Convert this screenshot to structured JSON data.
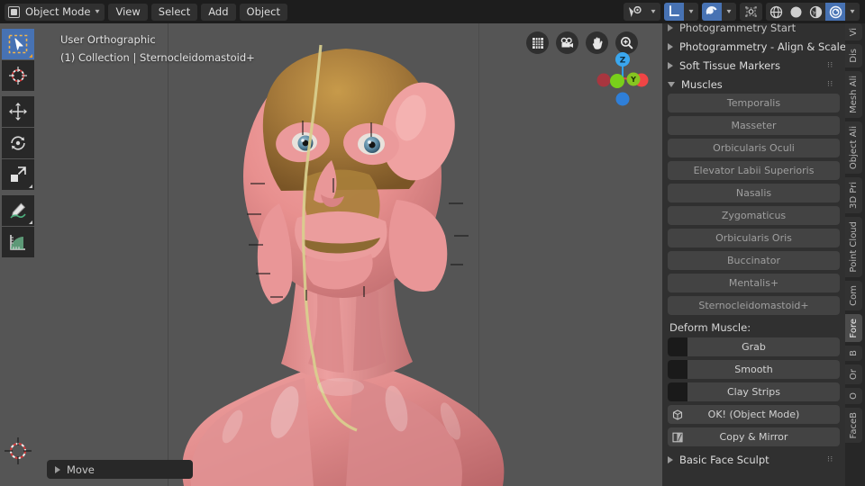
{
  "app": {
    "name": "Blender 3D Viewport",
    "accent": "#4772b3",
    "panel_bg": "#303030",
    "viewport_bg": "#555555"
  },
  "topbar": {
    "mode_selector": {
      "label": "Object Mode",
      "icon": "object-mode-icon",
      "chevron": "▾"
    },
    "menus": [
      {
        "label": "View"
      },
      {
        "label": "Select"
      },
      {
        "label": "Add"
      },
      {
        "label": "Object"
      }
    ],
    "right_controls": [
      {
        "name": "visibility-icon",
        "glyph": "◉",
        "active": false
      },
      {
        "name": "visibility-dropdown",
        "glyph": "▾",
        "active": false
      },
      {
        "name": "transform-orientation-icon",
        "glyph": "└",
        "active": true
      },
      {
        "name": "transform-orientation-dropdown",
        "glyph": "▾",
        "active": false
      },
      {
        "name": "snap-magnet-icon",
        "glyph": "◑",
        "active": true
      },
      {
        "name": "snap-dropdown",
        "glyph": "▾",
        "active": false
      },
      {
        "name": "proportional-editing-icon",
        "glyph": "⬚",
        "active": false
      },
      {
        "name": "shading-wireframe-icon",
        "glyph": "⊕",
        "active": false
      },
      {
        "name": "shading-solid-icon",
        "glyph": "●",
        "active": false
      },
      {
        "name": "shading-material-preview-icon",
        "glyph": "◕",
        "active": false
      },
      {
        "name": "shading-rendered-icon",
        "glyph": "◎",
        "active": true
      },
      {
        "name": "shading-dropdown",
        "glyph": "▾",
        "active": false
      }
    ]
  },
  "toolbar": {
    "tools": [
      {
        "name": "tweak-select-box-tool",
        "icon": "cursor-arrow-icon",
        "selected": true
      },
      {
        "name": "cursor-tool",
        "icon": "3d-cursor-icon",
        "selected": false
      },
      {
        "name": "move-tool",
        "icon": "move-arrows-icon",
        "selected": false
      },
      {
        "name": "rotate-tool",
        "icon": "rotate-icon",
        "selected": false
      },
      {
        "name": "scale-tool",
        "icon": "scale-icon",
        "selected": false
      },
      {
        "name": "annotate-tool",
        "icon": "pencil-icon",
        "selected": false
      },
      {
        "name": "measure-tool",
        "icon": "ruler-icon",
        "selected": false
      }
    ]
  },
  "viewport": {
    "view_name": "User Orthographic",
    "collection_line": "(1) Collection | Sternocleidomastoid+",
    "nav_buttons": [
      {
        "name": "toggle-grid-button",
        "icon": "grid-icon"
      },
      {
        "name": "toggle-camera-button",
        "icon": "camera-icon"
      },
      {
        "name": "pan-view-button",
        "icon": "hand-icon"
      },
      {
        "name": "zoom-view-button",
        "icon": "magnifier-plus-icon"
      }
    ],
    "axis_gizmo": {
      "axes": [
        {
          "label": "Z",
          "color": "#2f9fe8",
          "filled": true
        },
        {
          "label": "Y",
          "color": "#8fd420",
          "filled": true
        },
        {
          "label": "X",
          "color": "#f04545",
          "filled": true
        },
        {
          "label": "",
          "color": "#a33a44",
          "filled": true
        },
        {
          "label": "",
          "color": "#7ed321",
          "filled": true
        },
        {
          "label": "",
          "color": "#2f7fd8",
          "filled": true
        }
      ]
    },
    "operator_panel": {
      "label": "Move",
      "collapsed": true
    }
  },
  "sidebar": {
    "panels": [
      {
        "name": "photogrammetry-start-panel",
        "label": "Photogrammetry Start",
        "expanded": false,
        "clipped": true
      },
      {
        "name": "photogrammetry-align-scale-panel",
        "label": "Photogrammetry - Align & Scale",
        "expanded": false,
        "clipped": false
      },
      {
        "name": "soft-tissue-markers-panel",
        "label": "Soft Tissue Markers",
        "expanded": false,
        "clipped": false
      },
      {
        "name": "muscles-panel",
        "label": "Muscles",
        "expanded": true,
        "clipped": false
      }
    ],
    "muscles": [
      {
        "label": "Temporalis"
      },
      {
        "label": "Masseter"
      },
      {
        "label": "Orbicularis Oculi"
      },
      {
        "label": "Elevator Labii Superioris"
      },
      {
        "label": "Nasalis"
      },
      {
        "label": "Zygomaticus"
      },
      {
        "label": "Orbicularis Oris"
      },
      {
        "label": "Buccinator"
      },
      {
        "label": "Mentalis+"
      },
      {
        "label": "Sternocleidomastoid+"
      }
    ],
    "deform_section": {
      "title": "Deform Muscle:",
      "buttons": [
        {
          "label": "Grab",
          "thumb": "brush-grab-thumb"
        },
        {
          "label": "Smooth",
          "thumb": "brush-smooth-thumb"
        },
        {
          "label": "Clay Strips",
          "thumb": "brush-clay-strips-thumb"
        },
        {
          "label": "OK! (Object Mode)",
          "thumb": "cube-icon"
        },
        {
          "label": "Copy & Mirror",
          "thumb": "mirror-icon"
        }
      ]
    },
    "footer_panel": {
      "name": "basic-face-sculpt-panel",
      "label": "Basic Face Sculpt",
      "expanded": false
    },
    "triangle_right": "▶",
    "triangle_down": "▼",
    "grip": "∷∷"
  },
  "vertical_tabs": [
    {
      "label": "Vi",
      "active": false
    },
    {
      "label": "Dis",
      "active": false
    },
    {
      "label": "Mesh Ali",
      "active": false
    },
    {
      "label": "Object Ali",
      "active": false
    },
    {
      "label": "3D Pri",
      "active": false
    },
    {
      "label": "Point Cloud",
      "active": false
    },
    {
      "label": "Com",
      "active": false
    },
    {
      "label": "Fore",
      "active": true
    },
    {
      "label": "B",
      "active": false
    },
    {
      "label": "Or",
      "active": false
    },
    {
      "label": "O",
      "active": false
    },
    {
      "label": "FaceB",
      "active": false
    }
  ]
}
